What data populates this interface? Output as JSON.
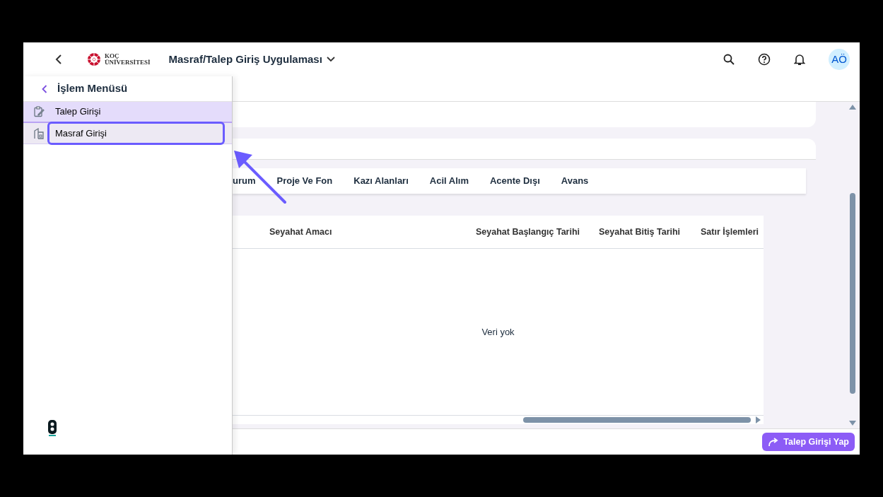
{
  "header": {
    "title": "Masraf/Talep Giriş Uygulaması",
    "logo_lines": [
      "KOÇ",
      "ÜNİVERSİTESİ"
    ],
    "avatar": "AÖ"
  },
  "sidebar": {
    "title": "İşlem Menüsü",
    "items": [
      {
        "label": "Talep Girişi",
        "selected": true,
        "highlighted": false
      },
      {
        "label": "Masraf Girişi",
        "selected": false,
        "highlighted": true
      }
    ]
  },
  "tabs": [
    {
      "label": "urum"
    },
    {
      "label": "Proje Ve Fon"
    },
    {
      "label": "Kazı Alanları"
    },
    {
      "label": "Acil Alım"
    },
    {
      "label": "Acente Dışı"
    },
    {
      "label": "Avans"
    }
  ],
  "table": {
    "columns": [
      "Seyahat Amacı",
      "Seyahat Başlangıç Tarihi",
      "Seyahat Bitiş Tarihi",
      "Satır İşlemleri"
    ],
    "empty_text": "Veri yok"
  },
  "footer": {
    "button": "Talep Girişi Yap"
  }
}
